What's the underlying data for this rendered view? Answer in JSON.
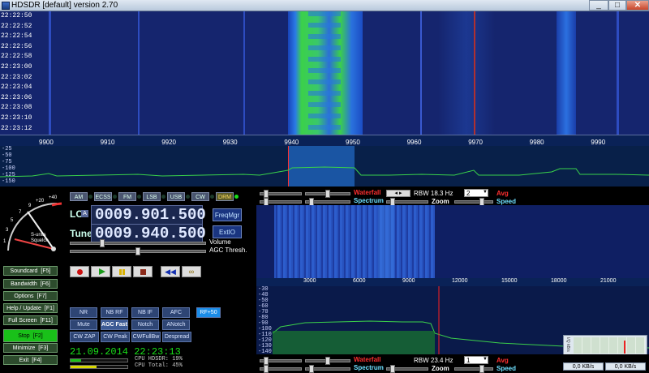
{
  "window": {
    "title": "HDSDR [default]  version 2.70",
    "minimize": "_",
    "maximize": "□",
    "close": "✕"
  },
  "waterfall": {
    "times": [
      "22:22:50",
      "22:22:52",
      "22:22:54",
      "22:22:56",
      "22:22:58",
      "22:23:00",
      "22:23:02",
      "22:23:04",
      "22:23:06",
      "22:23:08",
      "22:23:10",
      "22:23:12"
    ],
    "freq_ticks": [
      "9900",
      "9910",
      "9920",
      "9930",
      "9940",
      "9950",
      "9960",
      "9970",
      "9980",
      "9990"
    ]
  },
  "spectrum": {
    "db_labels": [
      "-25",
      "-50",
      "-75",
      "-100",
      "-125",
      "-150"
    ]
  },
  "modes": [
    "AM",
    "ECSS",
    "FM",
    "LSB",
    "USB",
    "CW",
    "DRM"
  ],
  "lo": {
    "label": "LO",
    "a_label": "A",
    "value": "0009.901.500",
    "freqmgr": "FreqMgr"
  },
  "tune": {
    "label": "Tune",
    "value": "0009.940.500",
    "extio": "ExtIO"
  },
  "smeter": {
    "label": "S-units",
    "sublabel": "Squelch",
    "scale": [
      "1",
      "3",
      "5",
      "7",
      "9",
      "+20",
      "+40"
    ]
  },
  "sliders": {
    "volume": "Volume",
    "agc": "AGC Thresh."
  },
  "side_buttons": [
    {
      "label": "Soundcard",
      "key": "[F5]"
    },
    {
      "label": "Bandwidth",
      "key": "[F6]"
    },
    {
      "label": "Options",
      "key": "[F7]"
    },
    {
      "label": "Help / Update",
      "key": "[F1]"
    },
    {
      "label": "Full Screen",
      "key": "[F11]"
    },
    {
      "label": "Stop",
      "key": "[F2]"
    },
    {
      "label": "Minimize",
      "key": "[F3]"
    },
    {
      "label": "Exit",
      "key": "[F4]"
    }
  ],
  "dsp_row1": [
    "NR",
    "NB RF",
    "NB IF",
    "AFC",
    "RF+50"
  ],
  "dsp_row2": [
    "Mute",
    "AGC Fast",
    "Notch",
    "ANotch"
  ],
  "dsp_row3": [
    "CW ZAP",
    "CW Peak",
    "CWFullBw",
    "Despread"
  ],
  "status": {
    "datetime": "21.09.2014 22:23:13",
    "cpu_hdsdr": "CPU HDSDR: 19%",
    "cpu_total": "CPU Total: 45%"
  },
  "rf_controls": {
    "waterfall": "Waterfall",
    "spectrum": "Spectrum",
    "rbw": "RBW 18.3 Hz",
    "rbw_select": "2",
    "avg": "Avg",
    "zoom": "Zoom",
    "speed": "Speed"
  },
  "af_controls": {
    "waterfall": "Waterfall",
    "spectrum": "Spectrum",
    "rbw": "RBW 23.4 Hz",
    "rbw_select": "1",
    "avg": "Avg",
    "zoom": "Zoom",
    "speed": "Speed"
  },
  "af_scale": [
    "3000",
    "6000",
    "9000",
    "12000",
    "15000",
    "18000",
    "21000"
  ],
  "af_db": [
    "-30",
    "-40",
    "-50",
    "-60",
    "-70",
    "-80",
    "-90",
    "-100",
    "-110",
    "-120",
    "-130",
    "-140"
  ],
  "net": {
    "title": "I/Q kB/s",
    "left": "0,0 KB/s",
    "right": "0,0 KB/s"
  },
  "colors": {
    "waterfall_bg": "#15256e",
    "signal_green": "#3bd04a",
    "active_green": "#19e019",
    "red_marker": "#ff2020"
  }
}
